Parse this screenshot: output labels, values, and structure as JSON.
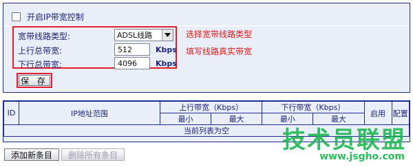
{
  "bandwidth": {
    "enable_label": "开启IP带宽控制",
    "line_type_label": "宽带线路类型:",
    "line_type_value": "ADSL线路",
    "up_total_label": "上行总带宽:",
    "up_total_value": "512",
    "down_total_label": "下行总带宽:",
    "down_total_value": "4096",
    "unit": "Kbps",
    "annotation_select": "选择宽带线路类型",
    "annotation_fill": "填写线路真实带宽",
    "save_label": "保 存"
  },
  "rules_table": {
    "headers": {
      "id": "ID",
      "ip_range": "IP地址范围",
      "up_bw": "上行带宽（Kbps）",
      "down_bw": "下行带宽（Kbps）",
      "enable": "启用",
      "config": "配置",
      "min": "最小",
      "max": "最大"
    },
    "empty_text": "当前列表为空"
  },
  "actions": {
    "add_label": "添加新条目",
    "delete_all_label": "删除所有条目"
  },
  "watermark": {
    "text": "技术员联盟",
    "url": "www.jsgho.com"
  },
  "colors": {
    "panel_bg": "#e9eef8",
    "border": "#1f2a8e",
    "highlight": "#e11d2a",
    "annotation": "#e01818",
    "watermark": "#13b54a"
  }
}
